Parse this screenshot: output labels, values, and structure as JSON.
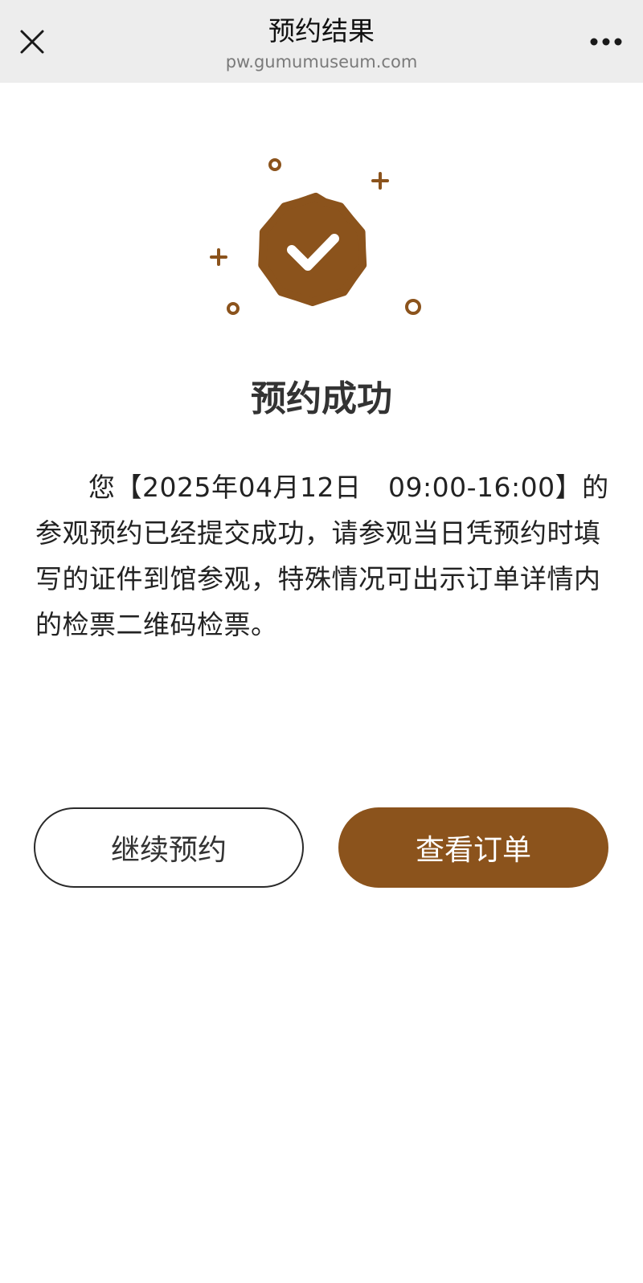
{
  "header": {
    "title": "预约结果",
    "url": "pw.gumumuseum.com"
  },
  "result": {
    "title": "预约成功",
    "message": "您【2025年04月12日　09:00-16:00】的参观预约已经提交成功，请参观当日凭预约时填写的证件到馆参观，特殊情况可出示订单详情内的检票二维码检票。"
  },
  "actions": {
    "continue_label": "继续预约",
    "view_order_label": "查看订单"
  },
  "icons": {
    "close": "close-icon",
    "more": "more-icon",
    "success": "check-badge-icon"
  },
  "colors": {
    "brand": "#8b531c",
    "header_bg": "#ededed"
  }
}
